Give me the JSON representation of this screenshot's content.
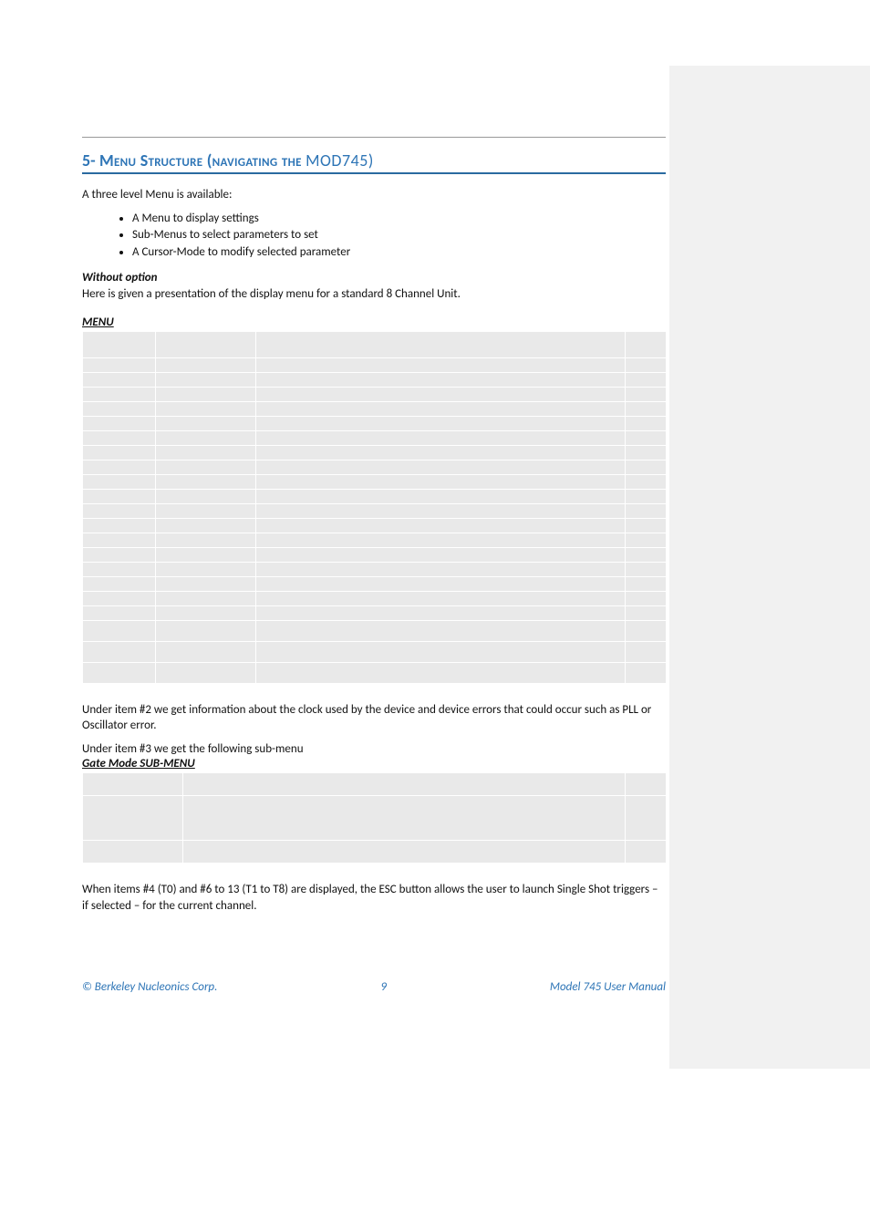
{
  "section": {
    "number": "5-",
    "title_main": " Menu Structure (navigating the ",
    "title_tail": "MOD745)"
  },
  "intro_line": "A three level Menu is available:",
  "bullets": [
    "A Menu to display settings",
    "Sub-Menus to select parameters to set",
    "A Cursor-Mode to modify selected parameter"
  ],
  "without_option_label": "Without option",
  "without_option_text": "Here is given a presentation of the display menu for a standard 8 Channel Unit.",
  "menu_label": "MENU",
  "menu_table": {
    "header": [
      "",
      "",
      "",
      ""
    ],
    "rows": [
      [
        "",
        "",
        "",
        ""
      ],
      [
        "",
        "",
        "",
        ""
      ],
      [
        "",
        "",
        "",
        ""
      ],
      [
        "",
        "",
        "",
        ""
      ],
      [
        "",
        "",
        "",
        ""
      ],
      [
        "",
        "",
        "",
        ""
      ],
      [
        "",
        "",
        "",
        ""
      ],
      [
        "",
        "",
        "",
        ""
      ],
      [
        "",
        "",
        "",
        ""
      ],
      [
        "",
        "",
        "",
        ""
      ],
      [
        "",
        "",
        "",
        ""
      ],
      [
        "",
        "",
        "",
        ""
      ],
      [
        "",
        "",
        "",
        ""
      ],
      [
        "",
        "",
        "",
        ""
      ],
      [
        "",
        "",
        "",
        ""
      ],
      [
        "",
        "",
        "",
        ""
      ],
      [
        "",
        "",
        "",
        ""
      ],
      [
        "",
        "",
        "",
        ""
      ],
      [
        "",
        "",
        "",
        ""
      ],
      [
        "",
        "",
        "",
        ""
      ],
      [
        "",
        "",
        "",
        ""
      ]
    ]
  },
  "para_item2": "Under item #2 we get information about the clock used by the device and device errors that could occur such as PLL or Oscillator error.",
  "para_item3_intro": "Under item #3 we get the following sub-menu",
  "gate_label": "Gate Mode SUB-MENU",
  "gate_table": {
    "header": [
      "",
      "",
      ""
    ],
    "rows": [
      [
        "",
        "",
        ""
      ],
      [
        "",
        "",
        ""
      ]
    ]
  },
  "para_items4": "When items #4 (T0) and #6 to 13 (T1 to T8) are displayed, the ESC button allows the user to launch Single Shot triggers – if selected – for the current channel.",
  "footer": {
    "left": "© Berkeley Nucleonics Corp.",
    "page": "9",
    "right": "Model 745 User Manual"
  }
}
